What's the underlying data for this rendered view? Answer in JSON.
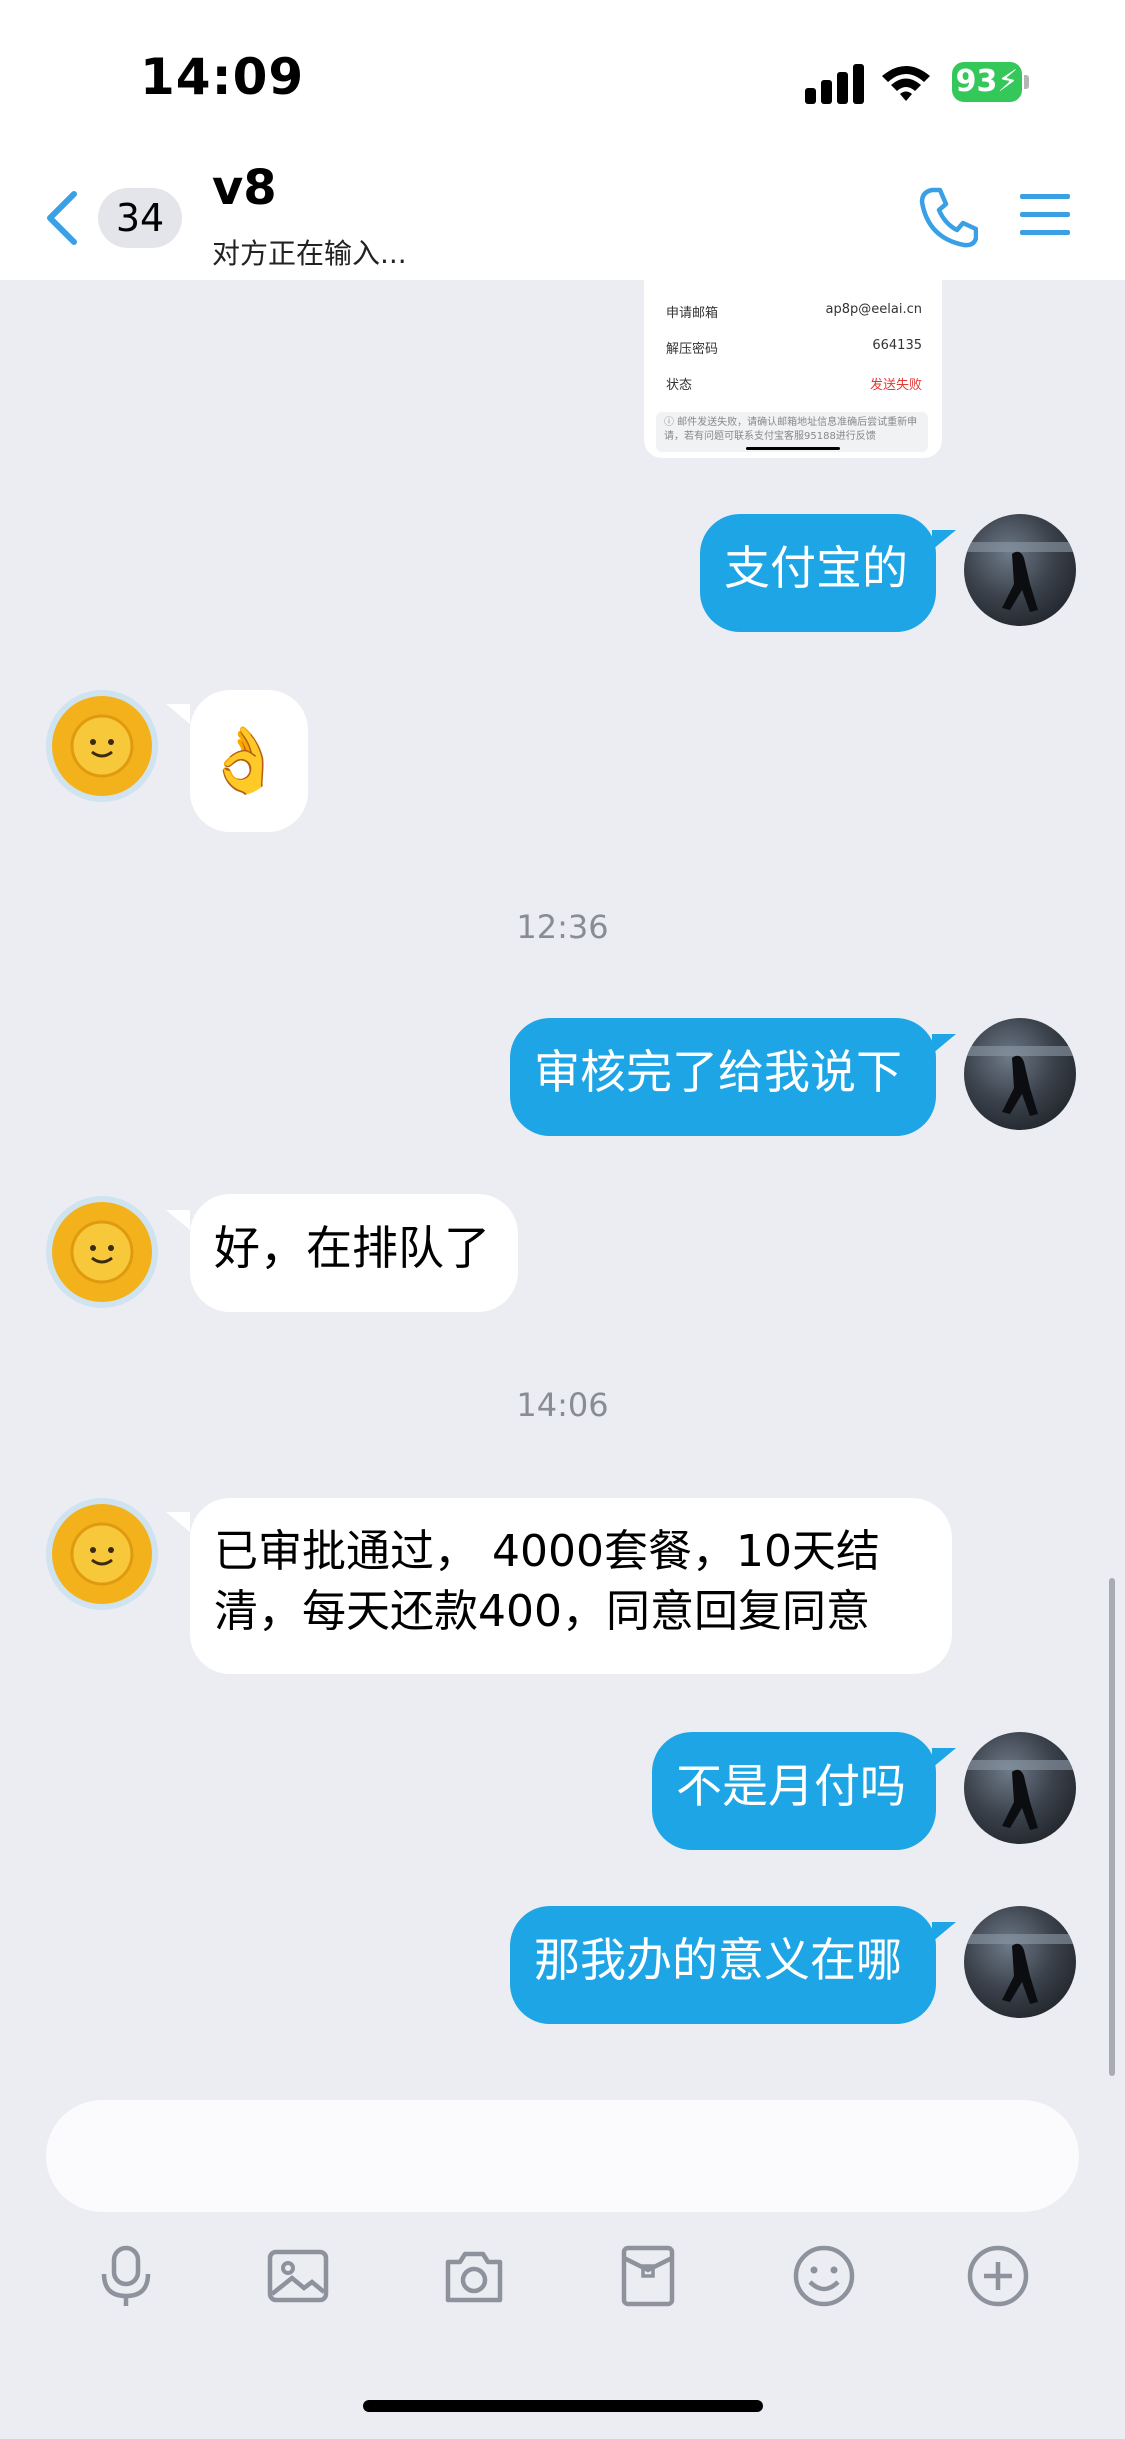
{
  "status_bar": {
    "time": "14:09",
    "battery": "93"
  },
  "header": {
    "unread_count": "34",
    "contact_name": "v8",
    "typing_status": "对方正在输入..."
  },
  "thumbnail": {
    "rows": [
      {
        "label": "申请邮箱",
        "value": "ap8p@eelai.cn"
      },
      {
        "label": "解压密码",
        "value": "664135"
      },
      {
        "label": "状态",
        "value": "发送失败"
      }
    ],
    "note": "ⓘ 邮件发送失败，请确认邮箱地址信息准确后尝试重新申请，若有问题可联系支付宝客服95188进行反馈",
    "status_color": "#e53935"
  },
  "messages": [
    {
      "from": "me",
      "text": "支付宝的"
    },
    {
      "from": "them",
      "text": "👌"
    },
    {
      "type": "time",
      "text": "12:36"
    },
    {
      "from": "me",
      "text": "审核完了给我说下"
    },
    {
      "from": "them",
      "text": "好，在排队了"
    },
    {
      "type": "time",
      "text": "14:06"
    },
    {
      "from": "them",
      "line1": "已审批通过， 4000套餐，10天结",
      "line2": "清，每天还款400，同意回复同意"
    },
    {
      "from": "me",
      "text": "不是月付吗"
    },
    {
      "from": "me",
      "text": "那我办的意义在哪"
    }
  ],
  "input": {
    "placeholder": ""
  },
  "toolbar": [
    "microphone-icon",
    "image-icon",
    "camera-icon",
    "red-packet-icon",
    "emoji-icon",
    "plus-icon"
  ],
  "colors": {
    "accent": "#1ea5e6",
    "icon_blue": "#3aa0e6",
    "battery": "#34c759"
  }
}
